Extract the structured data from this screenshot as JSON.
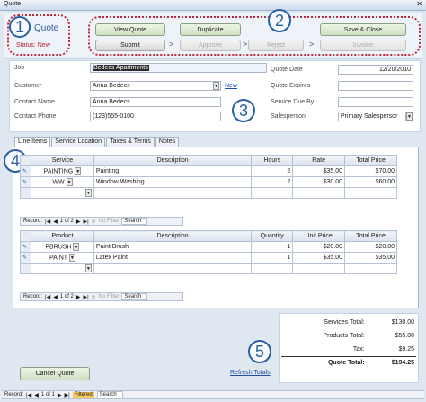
{
  "window": {
    "title": "Quote"
  },
  "header": {
    "title": "Quote",
    "status_label": "Status:",
    "status_value": "New"
  },
  "actions": {
    "view_quote": "View Quote",
    "duplicate": "Duplicate",
    "save_close": "Save & Close",
    "submit": "Submit",
    "approve": "Approve",
    "reject": "Reject",
    "invoice": "Invoice",
    "arrow": ">"
  },
  "callouts": {
    "c1": "1",
    "c2": "2",
    "c3": "3",
    "c4": "4",
    "c5": "5"
  },
  "form": {
    "job_label": "Job",
    "job_value": "Bedecs Apartments",
    "customer_label": "Customer",
    "customer_value": "Anna Bedecs",
    "new_link": "New",
    "contact_name_label": "Contact Name",
    "contact_name_value": "Anna Bedecs",
    "contact_phone_label": "Contact Phone",
    "contact_phone_value": "(123)555-0100",
    "quote_date_label": "Quote Date",
    "quote_date_value": "12/20/2010",
    "quote_expires_label": "Quote Expires",
    "quote_expires_value": "",
    "service_due_label": "Service Due By",
    "service_due_value": "",
    "salesperson_label": "Salesperson",
    "salesperson_value": "Primary Salespersor"
  },
  "tabs": [
    "Line Items",
    "Service Location",
    "Taxes & Terms",
    "Notes"
  ],
  "services": {
    "headers": [
      "Service",
      "Description",
      "Hours",
      "Rate",
      "Total Price"
    ],
    "rows": [
      [
        "PAINTING",
        "Painting",
        "2",
        "$35.00",
        "$70.00"
      ],
      [
        "WW",
        "Window Washing",
        "2",
        "$30.00",
        "$60.00"
      ]
    ],
    "nav": {
      "record": "Record:",
      "pos": "1 of 2",
      "filter": "No Filter",
      "search": "Search"
    }
  },
  "products": {
    "headers": [
      "Product",
      "Description",
      "Quantity",
      "Unit Price",
      "Total Price"
    ],
    "rows": [
      [
        "PBRUSH",
        "Paint Brush",
        "1",
        "$20.00",
        "$20.00"
      ],
      [
        "PAINT",
        "Latex Paint",
        "1",
        "$35.00",
        "$35.00"
      ]
    ],
    "nav": {
      "record": "Record:",
      "pos": "1 of 2",
      "filter": "No Filter",
      "search": "Search"
    }
  },
  "totals": {
    "services_label": "Services Total:",
    "services_value": "$130.00",
    "products_label": "Products Total:",
    "products_value": "$55.00",
    "tax_label": "Tax:",
    "tax_value": "$9.25",
    "quote_label": "Quote Total:",
    "quote_value": "$194.25"
  },
  "footer": {
    "cancel": "Cancel Quote",
    "refresh": "Refresh Totals",
    "record": "Record:",
    "pos": "1 of 1",
    "filtered": "Filtered",
    "search": "Search"
  }
}
